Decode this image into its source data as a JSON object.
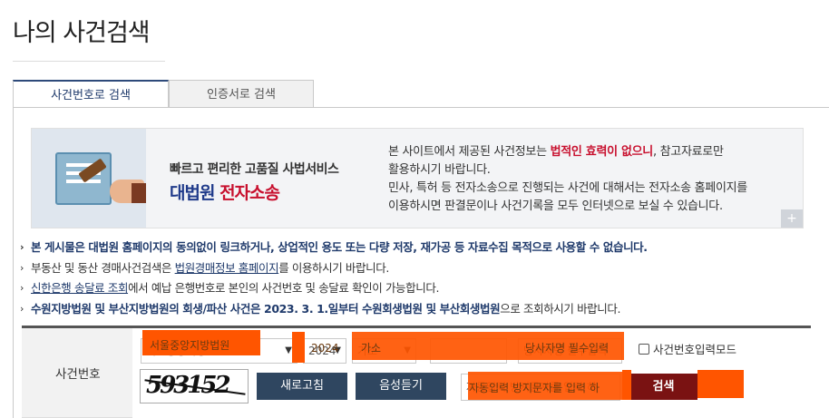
{
  "page": {
    "title": "나의 사건검색"
  },
  "tabs": [
    {
      "label": "사건번호로 검색",
      "active": true
    },
    {
      "label": "인증서로 검색",
      "active": false
    }
  ],
  "banner": {
    "tagline": "빠르고 편리한 고품질 사법서비스",
    "brand_main": "대법원",
    "brand_accent": "전자소송",
    "line1_pre": "본 사이트에서 제공된 사건정보는 ",
    "line1_em": "법적인 효력이 없으니",
    "line1_post": ", 참고자료로만",
    "line2": "활용하시기 바랍니다.",
    "line3": "민사, 특허 등 전자소송으로 진행되는 사건에 대해서는 전자소송 홈페이지를",
    "line4": "이용하시면 판결문이나 사건기록을 모두 인터넷으로 보실 수 있습니다.",
    "plus": "+"
  },
  "notices": {
    "n1": "본 게시물은 대법원 홈페이지의 동의없이 링크하거나, 상업적인 용도 또는 다량 저장, 재가공 등 자료수집 목적으로 사용할 수 없습니다.",
    "n2_pre": "부동산 및 동산 경매사건검색은 ",
    "n2_link": "법원경매정보 홈페이지",
    "n2_post": "를 이용하시기 바랍니다.",
    "n3_link": "신한은행 송달료 조회",
    "n3_post": "에서 예납 은행번호로 본인의 사건번호 및 송달료 확인이 가능합니다.",
    "n4_bold": "수원지방법원 및 부산지방법원의 회생/파산 사건은 2023. 3. 1.일부터 수원회생법원 및 부산회생법원",
    "n4_post": "으로 조회하시기 바랍니다."
  },
  "search": {
    "label": "사건번호",
    "court": "서울중앙지방법원",
    "year": "2024",
    "case_type": "가소",
    "case_number": "",
    "party_placeholder": "당사자명 필수입력",
    "case_mode_label": "사건번호입력모드",
    "captcha_text": "593152",
    "refresh_label": "새로고침",
    "audio_label": "음성듣기",
    "captcha_placeholder": "자동입력 방지문자를 입력 하",
    "search_label": "검색"
  },
  "colors": {
    "mask": "#ff5500",
    "accent_red": "#c8102e",
    "brand_blue": "#1f3a8a",
    "search_button": "#7a1212",
    "dark_button": "#2f4660"
  }
}
